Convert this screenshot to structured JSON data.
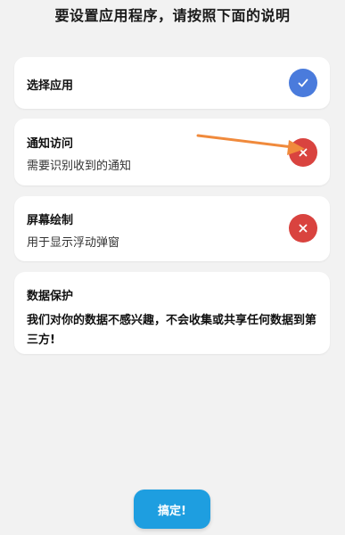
{
  "header": {
    "title": "要设置应用程序，请按照下面的说明"
  },
  "steps": [
    {
      "title": "选择应用",
      "subtitle": "",
      "status": "done",
      "status_icon": "check-icon"
    },
    {
      "title": "通知访问",
      "subtitle": "需要识别收到的通知",
      "status": "missing",
      "status_icon": "close-icon"
    },
    {
      "title": "屏幕绘制",
      "subtitle": "用于显示浮动弹窗",
      "status": "missing",
      "status_icon": "close-icon"
    }
  ],
  "privacy": {
    "title": "数据保护",
    "body": "我们对你的数据不感兴趣，不会收集或共享任何数据到第三方!"
  },
  "footer": {
    "ok_label": "搞定!"
  },
  "colors": {
    "background": "#f2f2f2",
    "card": "#ffffff",
    "done": "#4a7bdc",
    "missing": "#d9433f",
    "button": "#1e9ee0",
    "arrow": "#f08a3c"
  }
}
